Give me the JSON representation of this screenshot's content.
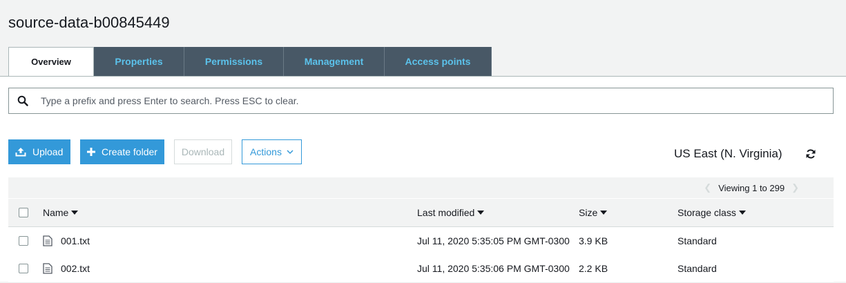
{
  "page": {
    "title": "source-data-b00845449"
  },
  "tabs": [
    {
      "label": "Overview",
      "active": true
    },
    {
      "label": "Properties"
    },
    {
      "label": "Permissions"
    },
    {
      "label": "Management"
    },
    {
      "label": "Access points"
    }
  ],
  "search": {
    "placeholder": "Type a prefix and press Enter to search. Press ESC to clear.",
    "value": ""
  },
  "toolbar": {
    "upload_label": "Upload",
    "create_folder_label": "Create folder",
    "download_label": "Download",
    "actions_label": "Actions"
  },
  "region": "US East (N. Virginia)",
  "pager": {
    "text": "Viewing 1 to 299"
  },
  "table": {
    "columns": [
      "Name",
      "Last modified",
      "Size",
      "Storage class"
    ],
    "rows": [
      {
        "name": "001.txt",
        "modified": "Jul 11, 2020 5:35:05 PM GMT-0300",
        "size": "3.9 KB",
        "class": "Standard"
      },
      {
        "name": "002.txt",
        "modified": "Jul 11, 2020 5:35:06 PM GMT-0300",
        "size": "2.2 KB",
        "class": "Standard"
      }
    ]
  },
  "colors": {
    "tab_bg": "#485866",
    "tab_text": "#5bc2eb",
    "primary": "#3399d9"
  }
}
